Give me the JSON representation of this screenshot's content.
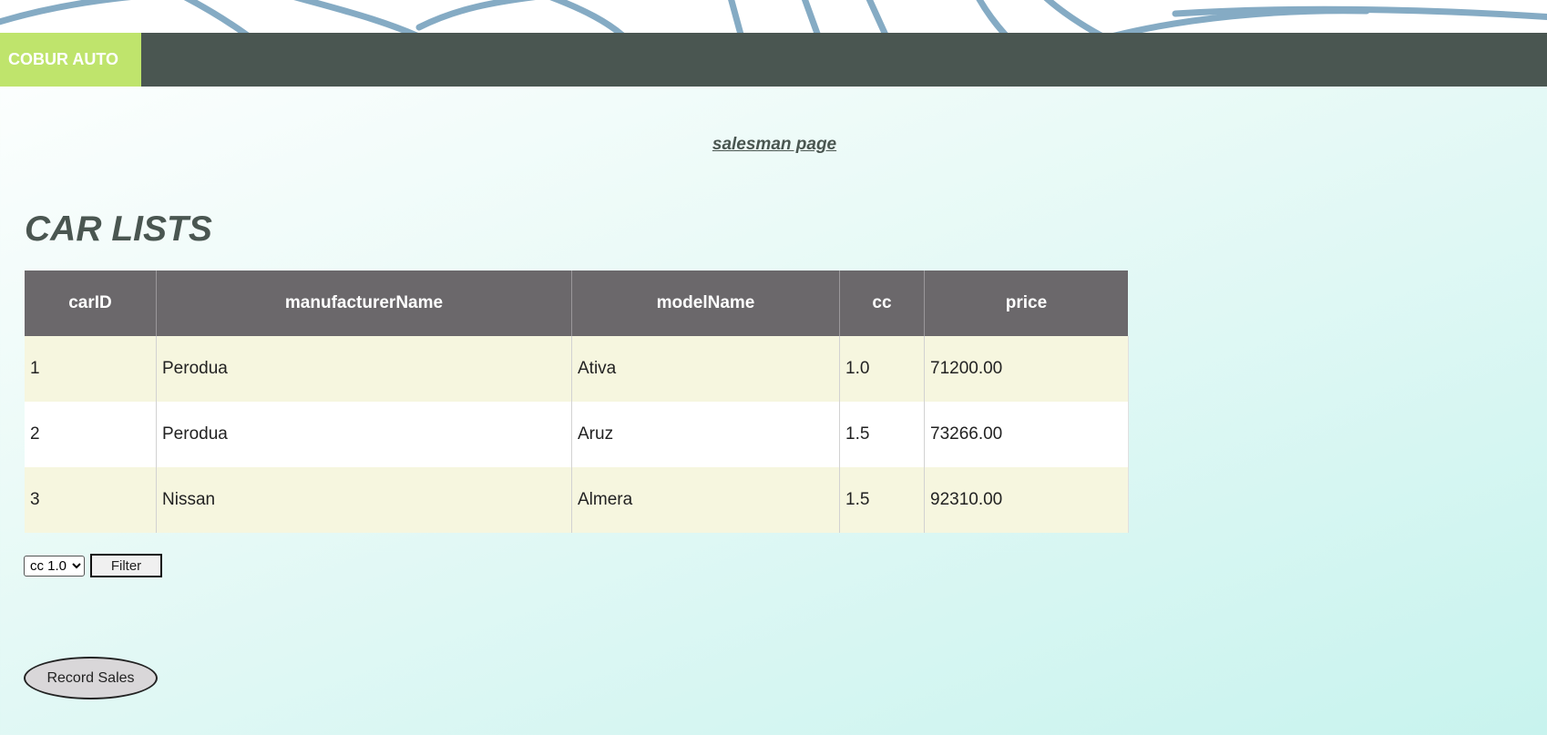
{
  "brand": {
    "name": "COBUR AUTO",
    "color": "#bfe46c"
  },
  "nav": {
    "background": "#4a5651"
  },
  "link": {
    "text": "salesman page"
  },
  "title": "CAR LISTS",
  "table": {
    "headers": [
      "carID",
      "manufacturerName",
      "modelName",
      "cc",
      "price"
    ],
    "rows": [
      [
        "1",
        "Perodua",
        "Ativa",
        "1.0",
        "71200.00"
      ],
      [
        "2",
        "Perodua",
        "Aruz",
        "1.5",
        "73266.00"
      ],
      [
        "3",
        "Nissan",
        "Almera",
        "1.5",
        "92310.00"
      ]
    ]
  },
  "filter": {
    "selected": "cc 1.0",
    "button_label": "Filter"
  },
  "record_button": "Record Sales"
}
